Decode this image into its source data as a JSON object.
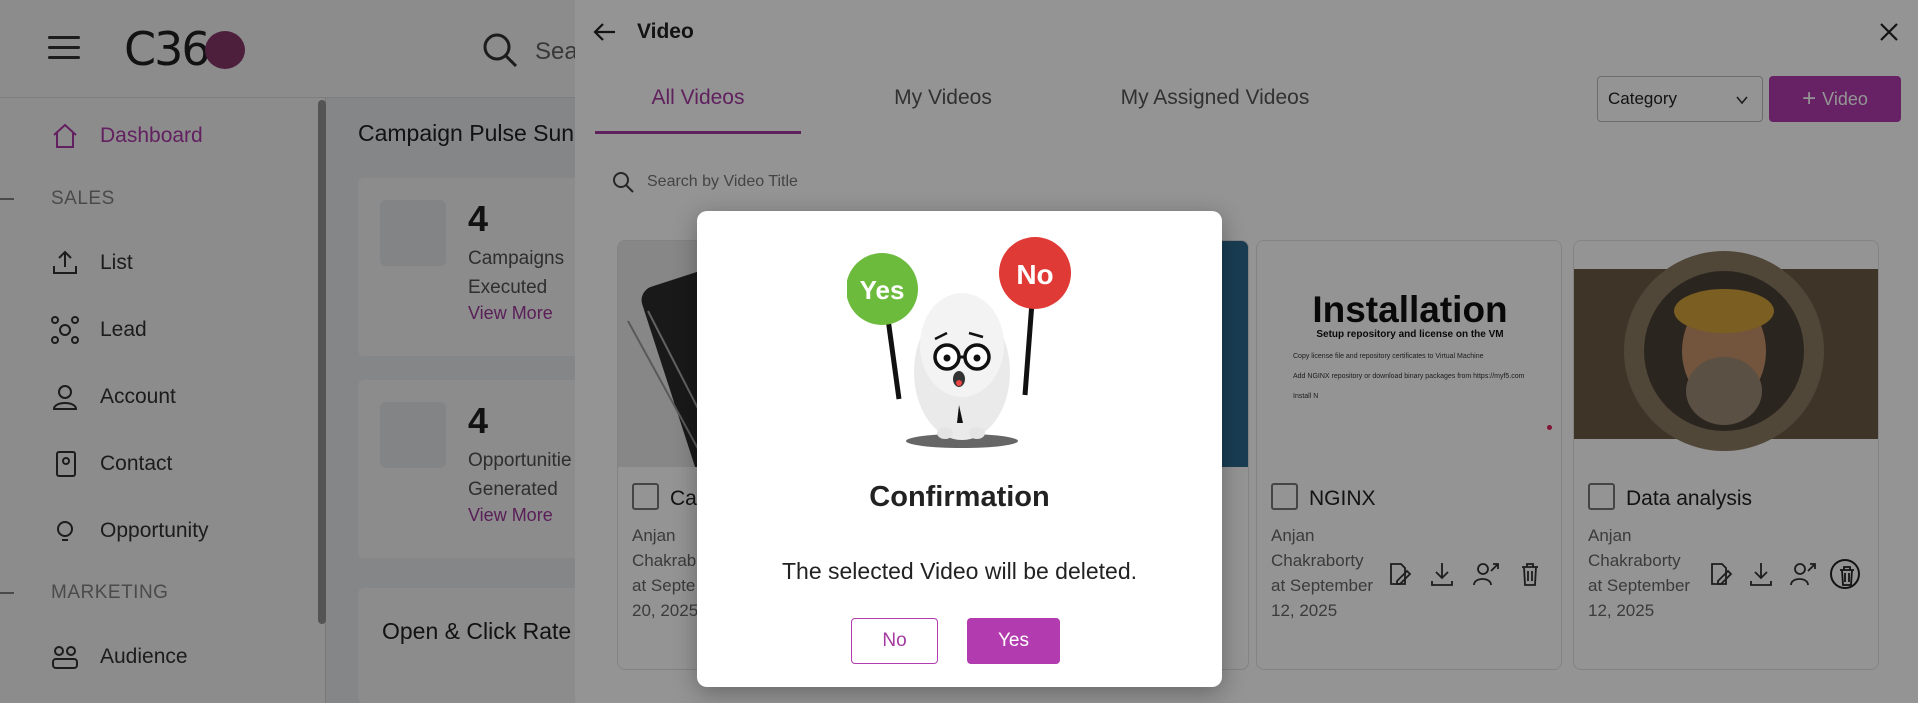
{
  "app": {
    "logo_text": "C36",
    "search_partial": "Sea",
    "sidebar": {
      "items": [
        {
          "label": "Dashboard",
          "icon": "home-icon",
          "active": true
        },
        {
          "label": "List",
          "icon": "upload-icon"
        },
        {
          "label": "Lead",
          "icon": "network-icon"
        },
        {
          "label": "Account",
          "icon": "person-icon"
        },
        {
          "label": "Contact",
          "icon": "contact-book-icon"
        },
        {
          "label": "Opportunity",
          "icon": "lightbulb-icon"
        },
        {
          "label": "Audience",
          "icon": "group-icon"
        }
      ],
      "sections": {
        "sales": "SALES",
        "marketing": "MARKETING"
      }
    },
    "main": {
      "title": "Campaign Pulse Sun",
      "cards": [
        {
          "value": "4",
          "label": "Campaigns Executed",
          "link": "View More"
        },
        {
          "value": "4",
          "label": "Opportunitie Generated",
          "link": "View More"
        }
      ],
      "rate_title": "Open & Click Rate"
    }
  },
  "drawer": {
    "title": "Video",
    "tabs": [
      "All Videos",
      "My Videos",
      "My Assigned Videos"
    ],
    "active_tab": "All Videos",
    "category_label": "Category",
    "add_button": "Video",
    "search_placeholder": "Search by Video Title",
    "videos": [
      {
        "title": "Ca",
        "author": "Anjan Chakrab",
        "date_line": "at Septe",
        "date_tail": "20, 2025"
      },
      {
        "title": "",
        "author": "",
        "date_line": "",
        "date_tail": ""
      },
      {
        "title": "NGINX",
        "author": "Anjan Chakraborty",
        "date_line": "at September",
        "date_tail": "12, 2025",
        "thumb": {
          "heading": "Installation",
          "sub": "Setup repository and license on the VM",
          "lines": [
            "Copy license file and repository certificates to Virtual Machine",
            "Add NGINX repository or download binary packages from https://myf5.com",
            "Install N"
          ]
        }
      },
      {
        "title": "Data analysis",
        "author": "Anjan Chakraborty",
        "date_line": "at September",
        "date_tail": "12, 2025"
      }
    ]
  },
  "modal": {
    "illustration_yes": "Yes",
    "illustration_no": "No",
    "title": "Confirmation",
    "message": "The selected Video will be deleted.",
    "no_label": "No",
    "yes_label": "Yes"
  },
  "colors": {
    "accent": "#b23bb0",
    "sign_yes": "#6dbb3d",
    "sign_no": "#e03a36"
  }
}
